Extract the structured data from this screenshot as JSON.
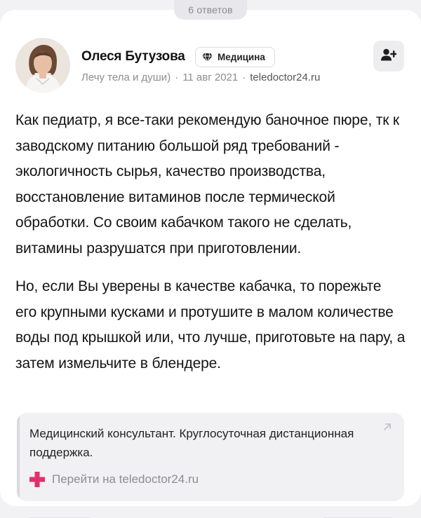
{
  "answers_count_label": "6 ответов",
  "author": {
    "name": "Олеся Бутузова",
    "badge": "Медицина",
    "bio": "Лечу тела и души)",
    "date": "11 авг 2021",
    "site": "teledoctor24.ru"
  },
  "answer": {
    "paragraphs": [
      "Как педиатр, я все-таки рекомендую баночное пюре, тк к заводскому питанию большой ряд требований - экологичность сырья, качество производства, восстановление витаминов после термической обработки. Со своим кабачком такого не сделать, витамины разрушатся при приготовлении.",
      "Но, если Вы уверены в качестве кабачка, то порежьте его крупными кусками и протушите в малом количестве воды под крышкой или, что лучше, приготовьте на пару, а затем измельчите в блендере."
    ]
  },
  "promo": {
    "text": "Медицинский консультант. Круглосуточная дистанционная поддержка.",
    "link_label": "Перейти на teledoctor24.ru"
  },
  "colors": {
    "accent_plus": "#e0306a",
    "page_bg": "#f2f2f4",
    "card_bg": "#ffffff"
  },
  "icons": {
    "badge": "diamond-icon",
    "subscribe": "add-user-icon",
    "promo_external": "arrow-up-right-icon",
    "promo_logo": "medical-plus-icon"
  }
}
